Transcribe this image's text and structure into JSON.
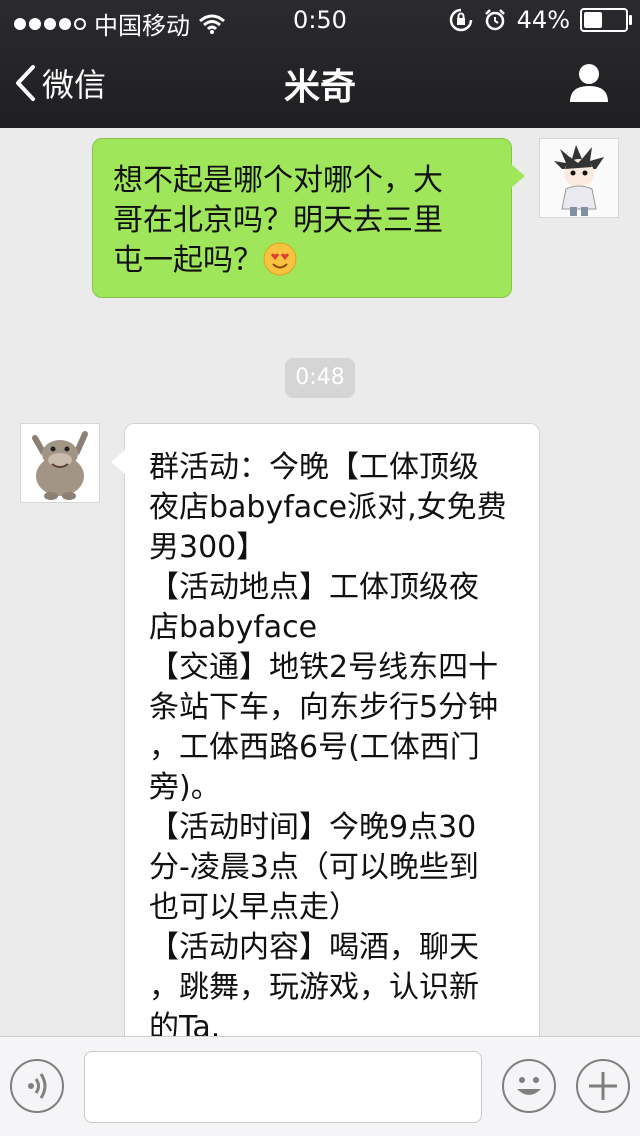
{
  "status_bar": {
    "carrier": "中国移动",
    "time": "0:50",
    "battery_percent": "44%",
    "battery_level": 0.44,
    "signal_bars_filled": 4,
    "signal_bars_total": 5
  },
  "nav": {
    "back_label": "微信",
    "title": "米奇"
  },
  "messages": [
    {
      "direction": "outgoing",
      "lines": [
        "想不起是哪个对哪个，大",
        "哥在北京吗？明天去三里",
        "屯一起吗？"
      ],
      "emoji": "smiling-face-with-heart-eyes"
    },
    {
      "type": "timestamp",
      "text": "0:48"
    },
    {
      "direction": "incoming",
      "lines": [
        "群活动：今晚【工体顶级",
        "夜店babyface派对,女免费",
        "男300】",
        "【活动地点】工体顶级夜",
        "店babyface",
        "【交通】地铁2号线东四十",
        "条站下车，向东步行5分钟",
        "，工体西路6号(工体西门",
        "旁)。",
        "【活动时间】今晚9点30",
        "分-凌晨3点（可以晚些到",
        "也可以早点走）",
        "【活动内容】喝酒，聊天",
        "，跳舞，玩游戏，认识新",
        "的Ta."
      ]
    }
  ],
  "colors": {
    "outgoing_bubble": "#9fe65a",
    "incoming_bubble": "#ffffff",
    "chat_background": "#ebebeb",
    "header": "#25252a"
  },
  "icons": {
    "back": "chevron-left-icon",
    "profile": "person-icon",
    "voice": "voice-icon",
    "emoji": "smiley-icon",
    "more": "plus-icon"
  }
}
